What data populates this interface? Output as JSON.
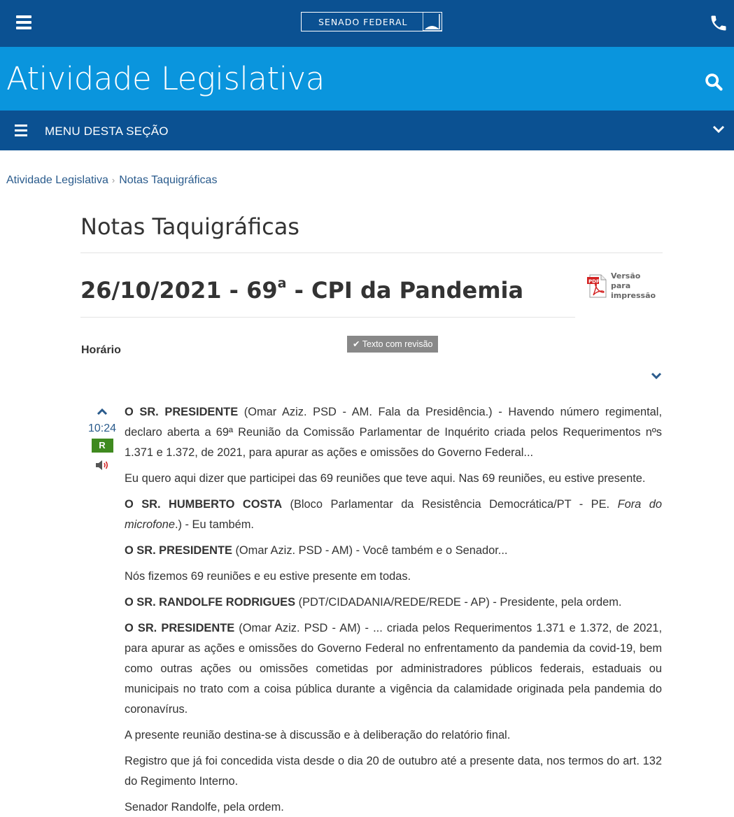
{
  "header": {
    "logo_text": "SENADO FEDERAL",
    "section_title": "Atividade Legislativa",
    "menu_label": "MENU DESTA SEÇÃO"
  },
  "breadcrumb": {
    "items": [
      "Atividade Legislativa",
      "Notas Taquigráficas"
    ]
  },
  "page": {
    "title": "Notas Taquigráficas",
    "session_date": "26/10/2021 - 69",
    "session_ordinal": "a",
    "session_name": " - CPI da Pandemia",
    "print_label": "Versão para impressão",
    "horario_label": "Horário",
    "revision_badge": "Texto com revisão"
  },
  "entry": {
    "time": "10:24",
    "badge": "R"
  },
  "transcript": [
    {
      "speaker": "O SR. PRESIDENTE",
      "text": " (Omar Aziz. PSD - AM. Fala da Presidência.) - Havendo número regimental, declaro aberta a 69ª Reunião da Comissão Parlamentar de Inquérito criada pelos Requerimentos nºs 1.371 e 1.372, de 2021, para apurar as ações e omissões do Governo Federal..."
    },
    {
      "speaker": "",
      "text": "Eu quero aqui dizer que participei das 69 reuniões que teve aqui. Nas 69 reuniões, eu estive presente."
    },
    {
      "speaker": "O SR. HUMBERTO COSTA",
      "text": " (Bloco Parlamentar da Resistência Democrática/PT - PE. ",
      "italic": "Fora do microfone",
      "after": ".) - Eu também."
    },
    {
      "speaker": "O SR. PRESIDENTE",
      "text": " (Omar Aziz. PSD - AM) - Você também e o Senador..."
    },
    {
      "speaker": "",
      "text": "Nós fizemos 69 reuniões e eu estive presente em todas."
    },
    {
      "speaker": "O SR. RANDOLFE RODRIGUES",
      "text": " (PDT/CIDADANIA/REDE/REDE - AP) - Presidente, pela ordem."
    },
    {
      "speaker": "O SR. PRESIDENTE",
      "text": " (Omar Aziz. PSD - AM) - ... criada pelos Requerimentos 1.371 e 1.372, de 2021, para apurar as ações e omissões do Governo Federal no enfrentamento da pandemia da covid-19, bem como outras ações ou omissões cometidas por administradores públicos federais, estaduais ou municipais no trato com a coisa pública durante a vigência da calamidade originada pela pandemia do coronavírus."
    },
    {
      "speaker": "",
      "text": "A presente reunião destina-se à discussão e à deliberação do relatório final."
    },
    {
      "speaker": "",
      "text": "Registro que já foi concedida vista desde o dia 20 de outubro até a presente data, nos termos do art. 132 do Regimento Interno."
    },
    {
      "speaker": "",
      "text": "Senador Randolfe, pela ordem."
    }
  ]
}
